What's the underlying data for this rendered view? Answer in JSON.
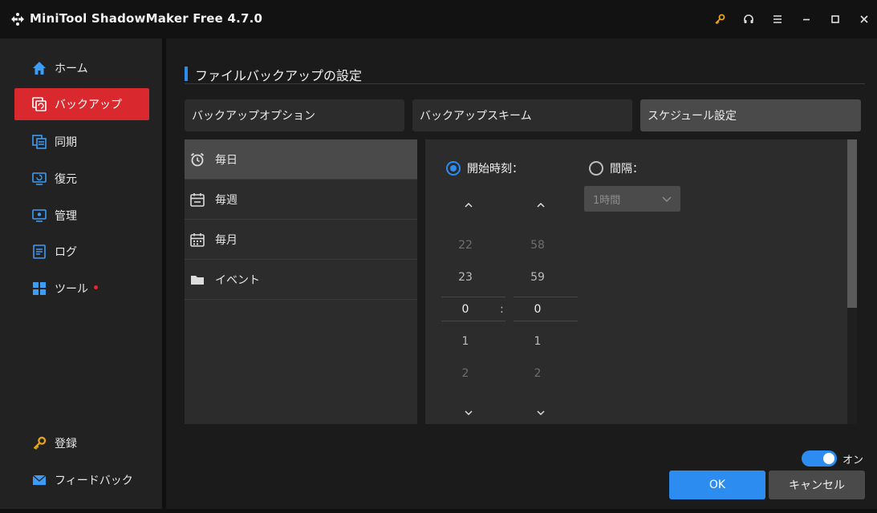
{
  "window": {
    "title": "MiniTool ShadowMaker Free 4.7.0",
    "controls": [
      "key-icon",
      "headset-icon",
      "menu-icon",
      "minimize-icon",
      "maximize-icon",
      "close-icon"
    ],
    "key_color": "#e8a317"
  },
  "sidebar": {
    "items": [
      {
        "label": "ホーム",
        "icon": "home-icon"
      },
      {
        "label": "バックアップ",
        "icon": "backup-icon",
        "active": true
      },
      {
        "label": "同期",
        "icon": "sync-icon"
      },
      {
        "label": "復元",
        "icon": "restore-icon"
      },
      {
        "label": "管理",
        "icon": "manage-icon"
      },
      {
        "label": "ログ",
        "icon": "log-icon"
      },
      {
        "label": "ツール",
        "icon": "tools-icon",
        "badge_dot": true
      }
    ],
    "bottom": [
      {
        "label": "登録",
        "icon": "key-icon"
      },
      {
        "label": "フィードバック",
        "icon": "mail-icon"
      }
    ],
    "active_color": "#d9292e"
  },
  "main": {
    "title": "ファイルバックアップの設定",
    "tabs": [
      {
        "label": "バックアップオプション"
      },
      {
        "label": "バックアップスキーム"
      },
      {
        "label": "スケジュール設定",
        "active": true
      }
    ],
    "schedule_types": [
      {
        "label": "毎日",
        "icon": "alarm-clock-icon",
        "active": true
      },
      {
        "label": "毎週",
        "icon": "calendar-week-icon"
      },
      {
        "label": "毎月",
        "icon": "calendar-month-icon"
      },
      {
        "label": "イベント",
        "icon": "folder-icon"
      }
    ],
    "start_time": {
      "label": "開始時刻：",
      "selected": true,
      "hours": [
        "22",
        "23",
        "0",
        "1",
        "2"
      ],
      "minutes": [
        "58",
        "59",
        "0",
        "1",
        "2"
      ],
      "separator": ":"
    },
    "interval": {
      "label": "間隔：",
      "selected": false,
      "value": "1時間"
    }
  },
  "footer": {
    "toggle_label": "オン",
    "toggle_on": true,
    "ok_label": "OK",
    "cancel_label": "キャンセル"
  },
  "accent": "#2d8cf0"
}
